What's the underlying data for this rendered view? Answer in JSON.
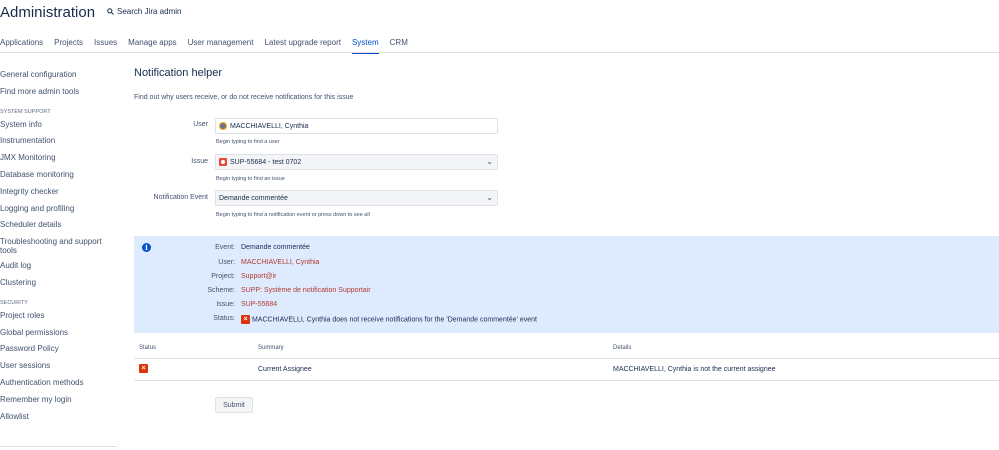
{
  "header": {
    "title": "Administration",
    "search_label": "Search Jira admin",
    "search_icon": "search-icon"
  },
  "nav": {
    "tabs": [
      "Applications",
      "Projects",
      "Issues",
      "Manage apps",
      "User management",
      "Latest upgrade report",
      "System",
      "CRM"
    ],
    "active": "System"
  },
  "sidebar": {
    "top_items": [
      "General configuration",
      "Find more admin tools"
    ],
    "system_support_heading": "SYSTEM SUPPORT",
    "system_support_items": [
      "System info",
      "Instrumentation",
      "JMX Monitoring",
      "Database monitoring",
      "Integrity checker",
      "Logging and profiling",
      "Scheduler details",
      "Troubleshooting and support tools",
      "Audit log",
      "Clustering"
    ],
    "security_heading": "SECURITY",
    "security_items": [
      "Project roles",
      "Global permissions",
      "Password Policy",
      "User sessions",
      "Authentication methods",
      "Remember my login",
      "Allowlist"
    ]
  },
  "main": {
    "title": "Notification helper",
    "intro": "Find out why users receive, or do not receive notifications for this issue",
    "user": {
      "label": "User",
      "value": "MACCHIAVELLI, Cynthia",
      "hint": "Begin typing to find a user"
    },
    "issue": {
      "label": "Issue",
      "value": "SUP-55684 - test 0702",
      "hint": "Begin typing to find an issue"
    },
    "event": {
      "label": "Notification Event",
      "value": "Demande commentée",
      "hint": "Begin typing to find a notification event or press down to see all"
    },
    "info": {
      "event_key": "Event:",
      "event_val": "Demande commentée",
      "user_key": "User:",
      "user_val": "MACCHIAVELLI, Cynthia",
      "project_key": "Project:",
      "project_val": "Support@ir",
      "scheme_key": "Scheme:",
      "scheme_val": "SUPP: Système de notification Supportair",
      "issue_key": "Issue:",
      "issue_val": "SUP-55684",
      "status_key": "Status:",
      "status_val": "MACCHIAVELLI, Cynthia does not receive notifications for the 'Demande commentée' event"
    },
    "table": {
      "headers": [
        "Status",
        "Summary",
        "Details"
      ],
      "row_summary": "Current Assignee",
      "row_details": "MACCHIAVELLI, Cynthia is not the current assignee"
    },
    "submit_label": "Submit"
  },
  "colors": {
    "accent": "#0052cc",
    "info_bg": "#deebff",
    "error": "#de350b",
    "link_red": "#b03a2e"
  }
}
